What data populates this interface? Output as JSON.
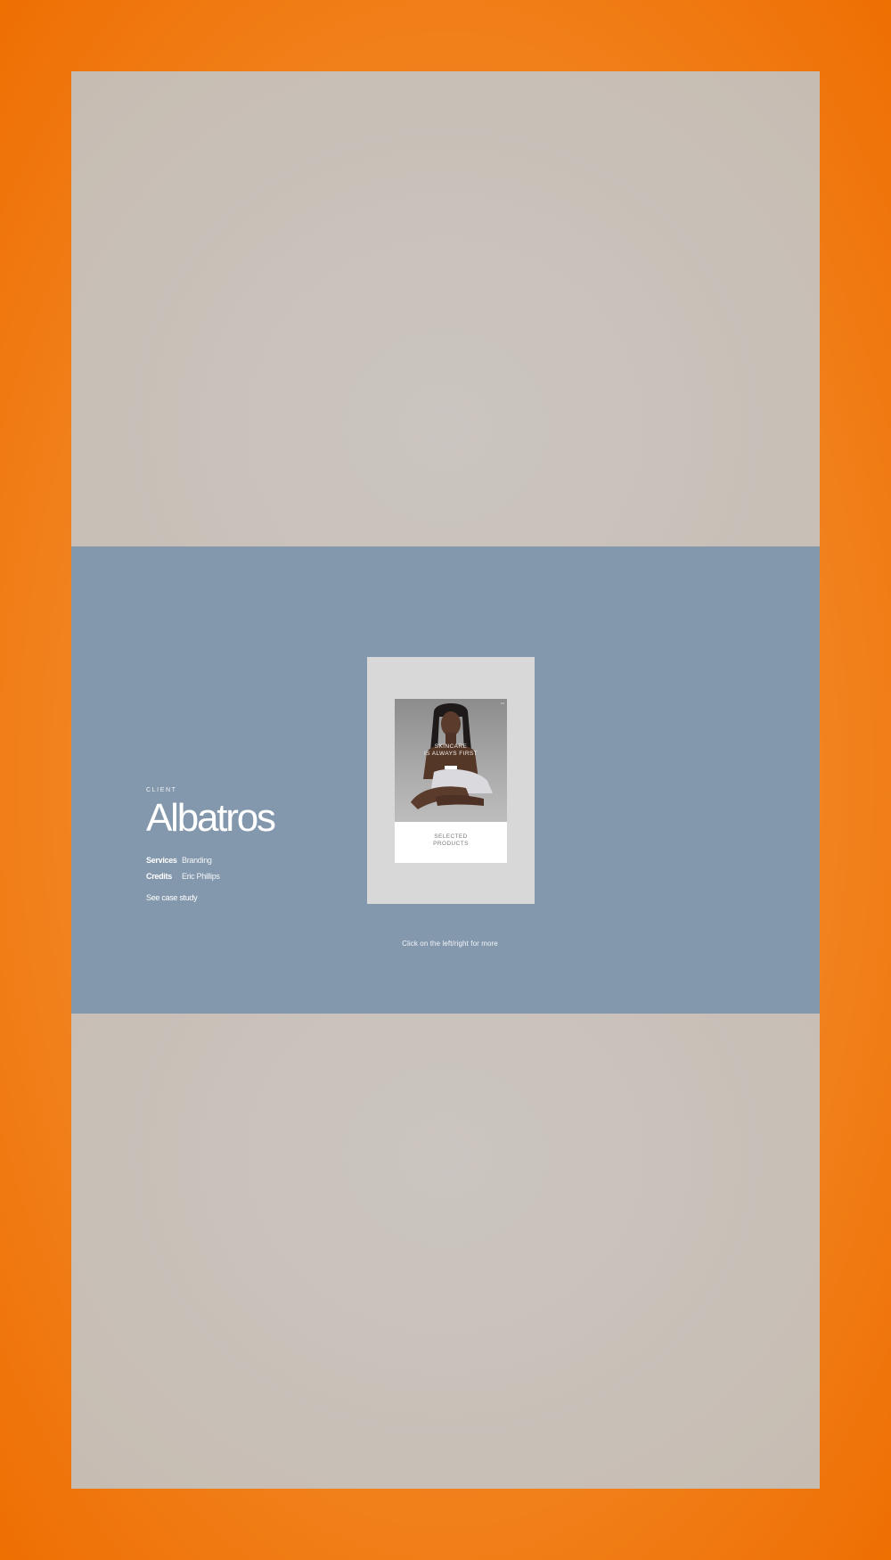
{
  "showcase": {
    "eyebrow": "CLIENT",
    "client_name": "Albatros",
    "meta": [
      {
        "key": "Services",
        "value": "Branding"
      },
      {
        "key": "Credits",
        "value": "Eric Phillips"
      }
    ],
    "case_study_link": "See case study",
    "preview": {
      "heading": "SKINCARE\nIS ALWAYS FIRST",
      "section_label": "SELECTED\nPRODUCTS"
    },
    "navigation_hint": "Click on the left/right for more"
  },
  "colors": {
    "page_background": "#ee6f02",
    "panel_neutral": "#c8bfb6",
    "panel_active": "#8498ad",
    "text_light": "#ffffff"
  }
}
